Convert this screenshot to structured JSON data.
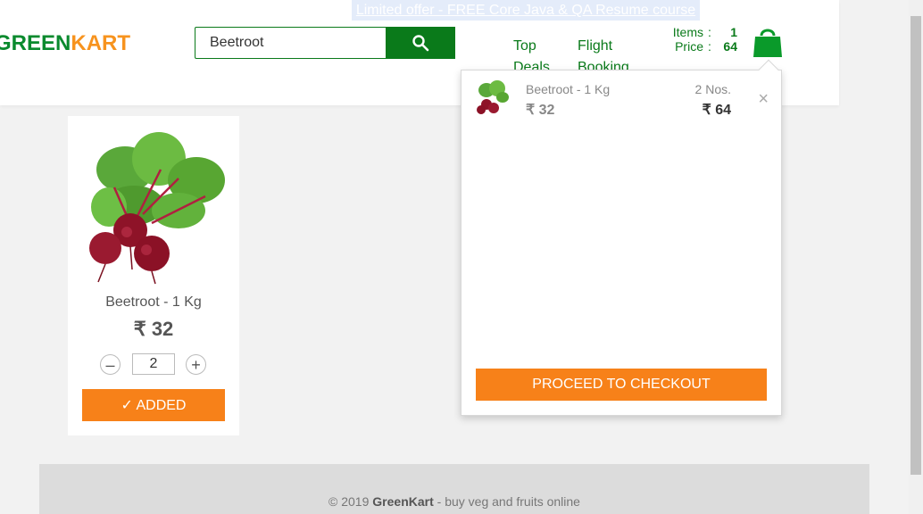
{
  "promo": {
    "text": "Limited offer - FREE Core Java & QA Resume course"
  },
  "brand": {
    "part1": "GREEN",
    "part2": "KART"
  },
  "search": {
    "value": "Beetroot",
    "icon": "search-icon"
  },
  "nav": {
    "top_deals": {
      "line1": "Top",
      "line2": "Deals"
    },
    "flight_booking": {
      "line1": "Flight",
      "line2": "Booking"
    }
  },
  "cart_summary": {
    "items_label": "Items",
    "items_value": "1",
    "price_label": "Price",
    "price_value": "64",
    "separator": ":",
    "icon": "shopping-bag-icon"
  },
  "product": {
    "name": "Beetroot - 1 Kg",
    "price": "₹ 32",
    "quantity": "2",
    "minus": "–",
    "plus": "+",
    "button_label": "✓ ADDED"
  },
  "cart_preview": {
    "item_name": "Beetroot - 1 Kg",
    "item_price": "₹ 32",
    "item_qty": "2 Nos.",
    "item_amount": "₹ 64",
    "remove": "×",
    "checkout_label": "PROCEED TO CHECKOUT"
  },
  "footer": {
    "copyright": "© 2019",
    "brand": "GreenKart",
    "tagline": "- buy veg and fruits online"
  },
  "colors": {
    "green": "#0a7a1a",
    "orange": "#f78119",
    "brand_green": "#0a8a2e",
    "brand_orange": "#f7931e"
  }
}
